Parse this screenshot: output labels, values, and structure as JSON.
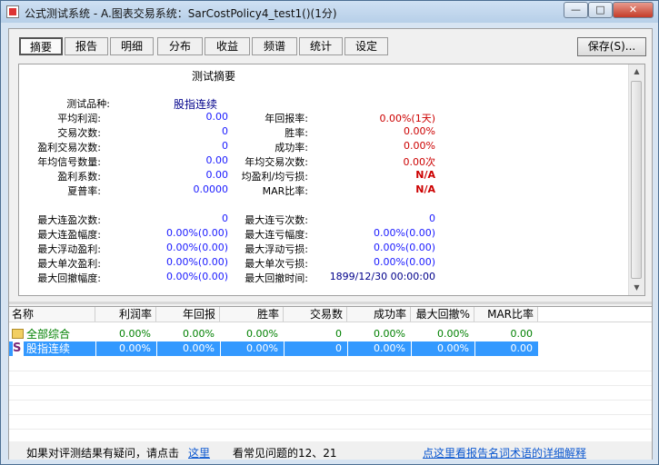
{
  "window": {
    "title": "公式测试系统 - A.图表交易系统：SarCostPolicy4_test1()(1分)",
    "min_glyph": "—",
    "max_glyph": "□",
    "close_glyph": "✕"
  },
  "tabs": [
    "摘要",
    "报告",
    "明细",
    "分布",
    "收益",
    "频谱",
    "统计",
    "设定"
  ],
  "save_label": "保存(S)...",
  "summary": {
    "title": "测试摘要",
    "product_label": "测试品种:",
    "product_value": "股指连续",
    "rows_left": [
      {
        "label": "平均利润:",
        "value": "0.00"
      },
      {
        "label": "交易次数:",
        "value": "0"
      },
      {
        "label": "盈利交易次数:",
        "value": "0"
      },
      {
        "label": "年均信号数量:",
        "value": "0.00"
      },
      {
        "label": "盈利系数:",
        "value": "0.00"
      },
      {
        "label": "夏普率:",
        "value": "0.0000"
      }
    ],
    "rows_right": [
      {
        "label": "年回报率:",
        "value": "0.00%(1天)"
      },
      {
        "label": "胜率:",
        "value": "0.00%"
      },
      {
        "label": "成功率:",
        "value": "0.00%"
      },
      {
        "label": "年均交易次数:",
        "value": "0.00次"
      },
      {
        "label": "均盈利/均亏损:",
        "value": "N/A"
      },
      {
        "label": "MAR比率:",
        "value": "N/A"
      }
    ],
    "rows2_left": [
      {
        "label": "最大连盈次数:",
        "value": "0"
      },
      {
        "label": "最大连盈幅度:",
        "value": "0.00%(0.00)"
      },
      {
        "label": "最大浮动盈利:",
        "value": "0.00%(0.00)"
      },
      {
        "label": "最大单次盈利:",
        "value": "0.00%(0.00)"
      },
      {
        "label": "最大回撤幅度:",
        "value": "0.00%(0.00)"
      }
    ],
    "rows2_right": [
      {
        "label": "最大连亏次数:",
        "value": "0"
      },
      {
        "label": "最大连亏幅度:",
        "value": "0.00%(0.00)"
      },
      {
        "label": "最大浮动亏损:",
        "value": "0.00%(0.00)"
      },
      {
        "label": "最大单次亏损:",
        "value": "0.00%(0.00)"
      },
      {
        "label": "最大回撤时间:",
        "value": "1899/12/30 00:00:00"
      }
    ]
  },
  "grid": {
    "headers": [
      "名称",
      "利润率",
      "年回报",
      "胜率",
      "交易数",
      "成功率",
      "最大回撤%",
      "MAR比率"
    ],
    "rows": [
      {
        "name": "全部综合",
        "icon": "folder-icon",
        "cells": [
          "0.00%",
          "0.00%",
          "0.00%",
          "0",
          "0.00%",
          "0.00%",
          "0.00"
        ]
      },
      {
        "name": "股指连续",
        "icon": "S",
        "cells": [
          "0.00%",
          "0.00%",
          "0.00%",
          "0",
          "0.00%",
          "0.00%",
          "0.00"
        ]
      }
    ]
  },
  "status": {
    "question_text": "如果对评测结果有疑问，请点击",
    "here_link": "这里",
    "faq_text": "看常见问题的12、21",
    "glossary_link": "点这里看报告名词术语的详细解释"
  },
  "colors": {
    "selection": "#3399ff",
    "value_blue": "#1a1aff",
    "value_red": "#cc0000",
    "green": "#008000"
  }
}
